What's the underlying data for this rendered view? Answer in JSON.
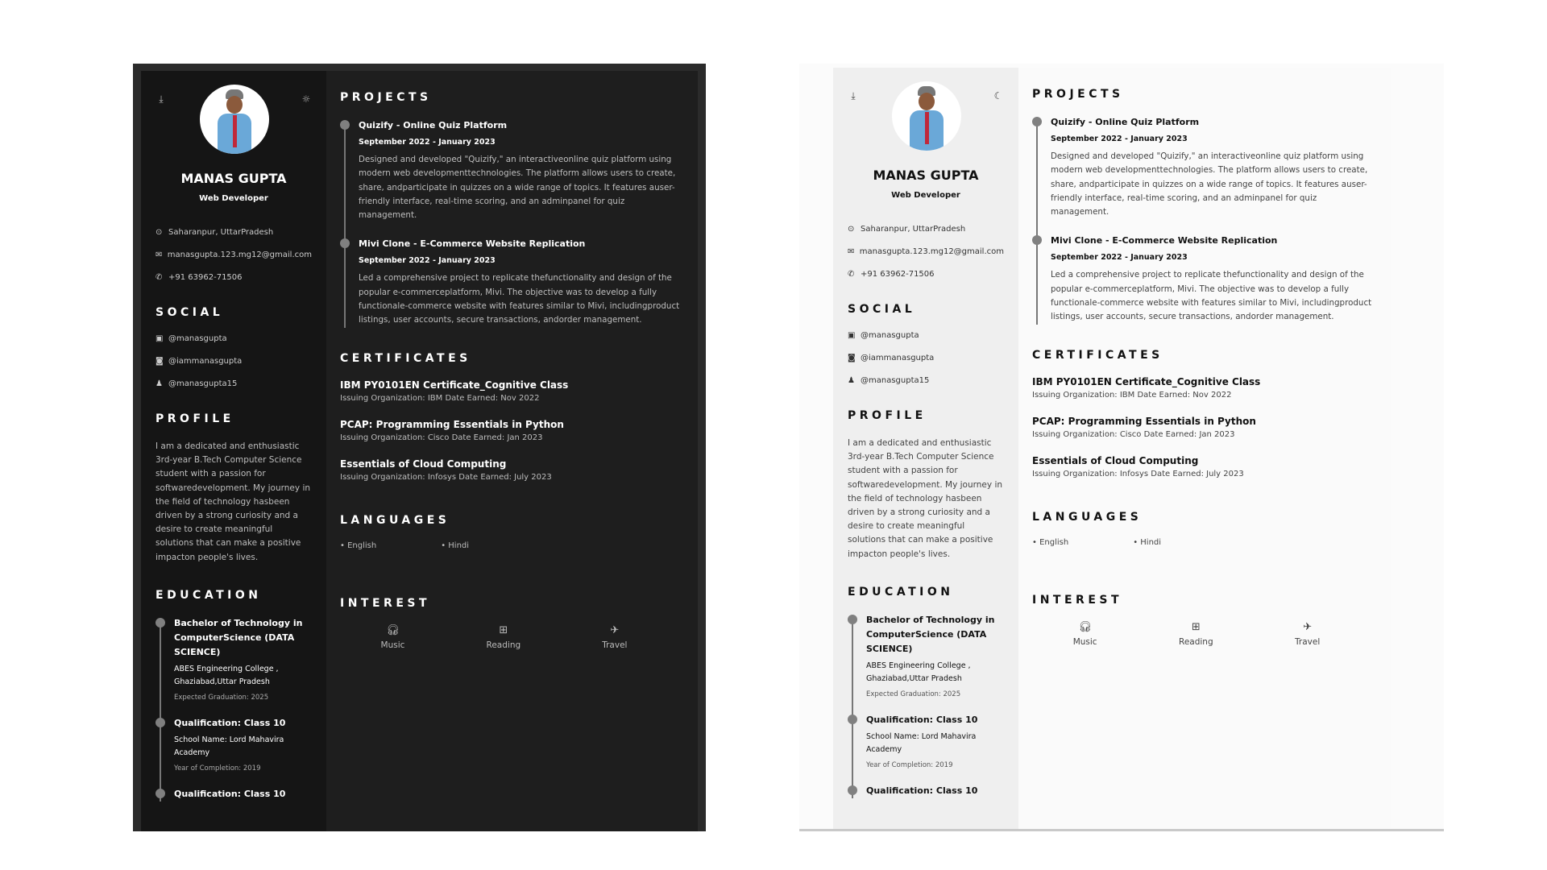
{
  "profile": {
    "name": "MANAS GUPTA",
    "role": "Web Developer",
    "location": "Saharanpur, UttarPradesh",
    "email": "manasgupta.123.mg12@gmail.com",
    "phone": "+91 63962-71506"
  },
  "headings": {
    "social": "SOCIAL",
    "profile": "PROFILE",
    "education": "EDUCATION",
    "projects": "PROJECTS",
    "certificates": "CERTIFICATES",
    "languages": "LANGUAGES",
    "interest": "INTEREST"
  },
  "social": [
    "@manasgupta",
    "@iammanasgupta",
    "@manasgupta15"
  ],
  "profile_text": "I am a dedicated and enthusiastic 3rd-year B.Tech Computer Science student with a passion for softwaredevelopment. My journey in the field of technology hasbeen driven by a strong curiosity and a desire to create meaningful solutions that can make a positive impacton people's lives.",
  "education": [
    {
      "title": "Bachelor of Technology in ComputerScience (DATA SCIENCE)",
      "school": "ABES Engineering College , Ghaziabad,Uttar Pradesh",
      "year": "Expected Graduation: 2025"
    },
    {
      "title": "Qualification: Class 10",
      "school": "School Name: Lord Mahavira Academy",
      "year": "Year of Completion: 2019"
    },
    {
      "title": "Qualification: Class 10"
    }
  ],
  "projects": [
    {
      "title": "Quizify - Online Quiz Platform",
      "date": "September 2022 - January 2023",
      "desc": "Designed and developed \"Quizify,\" an interactiveonline quiz platform using modern web developmenttechnologies. The platform allows users to create, share, andparticipate in quizzes on a wide range of topics. It features auser-friendly interface, real-time scoring, and an adminpanel for quiz management."
    },
    {
      "title": "Mivi Clone - E-Commerce Website Replication",
      "date": "September 2022 - January 2023",
      "desc": "Led a comprehensive project to replicate thefunctionality and design of the popular e-commerceplatform, Mivi. The objective was to develop a fully functionale-commerce website with features similar to Mivi, includingproduct listings, user accounts, secure transactions, andorder management."
    }
  ],
  "certificates": [
    {
      "title": "IBM PY0101EN Certificate_Cognitive Class",
      "sub": "Issuing Organization: IBM Date Earned: Nov 2022"
    },
    {
      "title": "PCAP: Programming Essentials in Python",
      "sub": "Issuing Organization: Cisco Date Earned: Jan 2023"
    },
    {
      "title": "Essentials of Cloud Computing",
      "sub": "Issuing Organization: Infosys Date Earned: July 2023"
    }
  ],
  "languages": [
    "English",
    "Hindi"
  ],
  "interests": [
    "Music",
    "Reading",
    "Travel"
  ],
  "themes": {
    "dark": {
      "toggle_icon": "sun-icon",
      "bg": "#1e1e1e"
    },
    "light": {
      "toggle_icon": "moon-icon",
      "bg": "#fafafa"
    }
  }
}
